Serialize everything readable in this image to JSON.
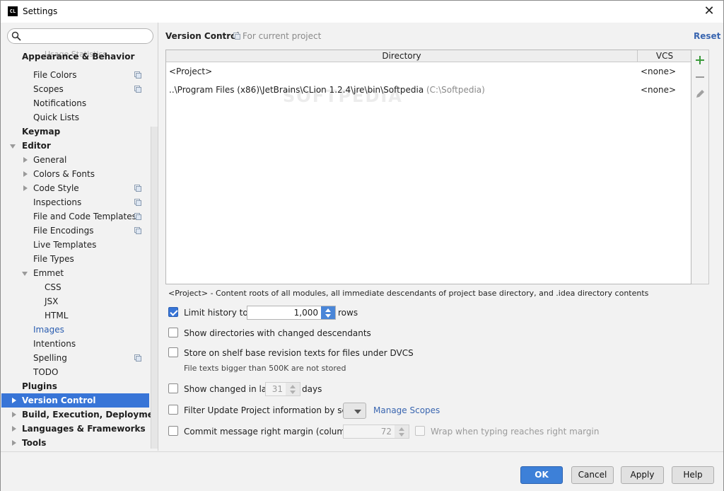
{
  "window": {
    "app_icon_text": "CL",
    "title": "Settings",
    "close": "✕"
  },
  "search": {
    "placeholder": ""
  },
  "sidebar": {
    "ghost_text": "Usage Statistics",
    "items": [
      {
        "label": "Appearance & Behavior",
        "bold": true
      },
      {
        "label": "File Colors"
      },
      {
        "label": "Scopes"
      },
      {
        "label": "Notifications"
      },
      {
        "label": "Quick Lists"
      },
      {
        "label": "Keymap",
        "bold": true
      },
      {
        "label": "Editor",
        "bold": true
      },
      {
        "label": "General"
      },
      {
        "label": "Colors & Fonts"
      },
      {
        "label": "Code Style"
      },
      {
        "label": "Inspections"
      },
      {
        "label": "File and Code Templates"
      },
      {
        "label": "File Encodings"
      },
      {
        "label": "Live Templates"
      },
      {
        "label": "File Types"
      },
      {
        "label": "Emmet"
      },
      {
        "label": "CSS"
      },
      {
        "label": "JSX"
      },
      {
        "label": "HTML"
      },
      {
        "label": "Images"
      },
      {
        "label": "Intentions"
      },
      {
        "label": "Spelling"
      },
      {
        "label": "TODO"
      },
      {
        "label": "Plugins",
        "bold": true
      },
      {
        "label": "Version Control",
        "bold": true,
        "selected": true
      },
      {
        "label": "Build, Execution, Deployment",
        "bold": true
      },
      {
        "label": "Languages & Frameworks",
        "bold": true
      },
      {
        "label": "Tools",
        "bold": true
      }
    ]
  },
  "main": {
    "title": "Version Control",
    "scope": "For current project",
    "reset": "Reset",
    "table": {
      "columns": [
        "Directory",
        "VCS"
      ],
      "rows": [
        {
          "directory": "<Project>",
          "directory_hint": "",
          "vcs": "<none>"
        },
        {
          "directory": "..\\Program Files (x86)\\JetBrains\\CLion 1.2.4\\jre\\bin\\Softpedia",
          "directory_hint": "(C:\\Softpedia)",
          "vcs": "<none>"
        }
      ],
      "watermark": "SOFTPEDIA"
    },
    "hint": "<Project> - Content roots of all modules, all immediate descendants of project base directory, and .idea directory contents",
    "options": {
      "limit_history": {
        "label": "Limit history to:",
        "checked": true,
        "value": "1,000",
        "suffix": "rows"
      },
      "show_dirs": {
        "label": "Show directories with changed descendants",
        "checked": false
      },
      "store_shelf": {
        "label": "Store on shelf base revision texts for files under DVCS",
        "checked": false,
        "note": "File texts bigger than 500K are not stored"
      },
      "show_changed": {
        "label": "Show changed in last",
        "checked": false,
        "value": "31",
        "suffix": "days"
      },
      "filter_update": {
        "label": "Filter Update Project information by scope",
        "checked": false,
        "link": "Manage Scopes"
      },
      "commit_margin": {
        "label": "Commit message right margin (columns):",
        "checked": false,
        "value": "72",
        "wrap_label": "Wrap when typing reaches right margin"
      }
    }
  },
  "footer": {
    "ok": "OK",
    "cancel": "Cancel",
    "apply": "Apply",
    "help": "Help"
  },
  "colors": {
    "selection": "#3875d7",
    "link": "#3a66b0",
    "primary_button": "#3d80d8",
    "add_green": "#3a9a3a"
  }
}
